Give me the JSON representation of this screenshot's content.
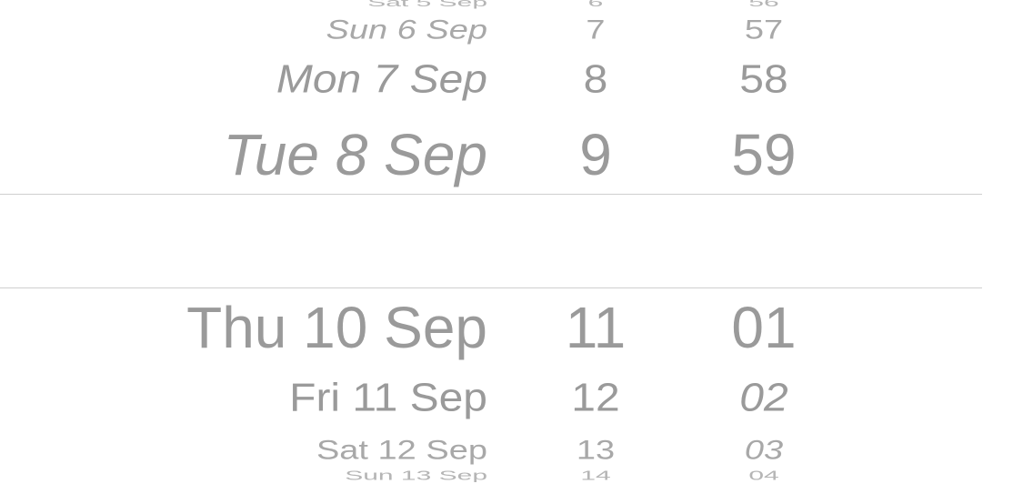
{
  "picker": {
    "dates": [
      "Sat 5 Sep",
      "Sun 6 Sep",
      "Mon 7 Sep",
      "Tue 8 Sep",
      "",
      "Thu 10 Sep",
      "Fri 11 Sep",
      "Sat 12 Sep",
      "Sun 13 Sep"
    ],
    "hours": [
      "6",
      "7",
      "8",
      "9",
      "",
      "11",
      "12",
      "13",
      "14"
    ],
    "minutes": [
      "56",
      "57",
      "58",
      "59",
      "",
      "01",
      "02",
      "03",
      "04"
    ]
  }
}
